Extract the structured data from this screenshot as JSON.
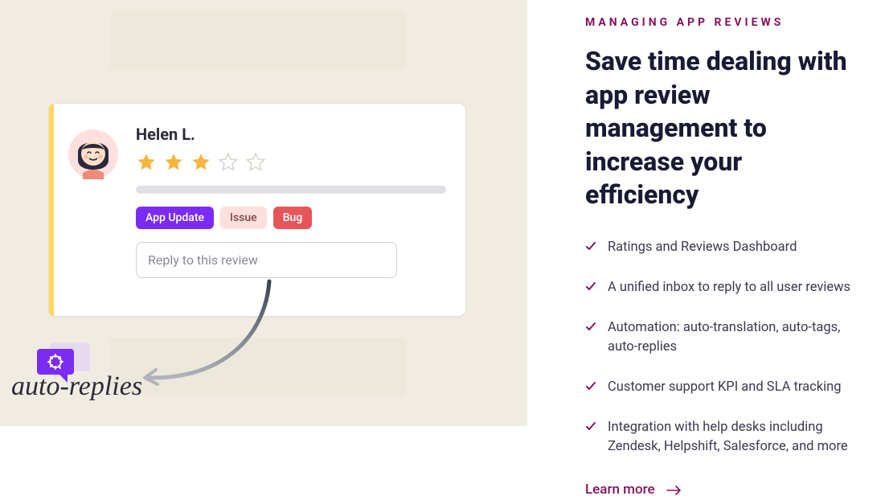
{
  "left": {
    "reviewer_name": "Helen L.",
    "rating_filled": 3,
    "rating_total": 5,
    "tags": {
      "update": "App Update",
      "issue": "Issue",
      "bug": "Bug"
    },
    "reply_placeholder": "Reply to this review",
    "callout_label": "auto-replies"
  },
  "right": {
    "eyebrow": "MANAGING APP REVIEWS",
    "headline": "Save time dealing with app review management to increase your efficiency",
    "features": [
      "Ratings and Reviews Dashboard",
      "A unified inbox to reply to all user reviews",
      "Automation: auto-translation, auto-tags, auto-replies",
      "Customer support KPI and SLA tracking",
      "Integration with help desks including Zendesk, Helpshift, Salesforce, and more"
    ],
    "cta": "Learn more"
  },
  "colors": {
    "star_filled": "#f5b63e",
    "star_empty": "#d8d6cf",
    "accent": "#84135c"
  }
}
